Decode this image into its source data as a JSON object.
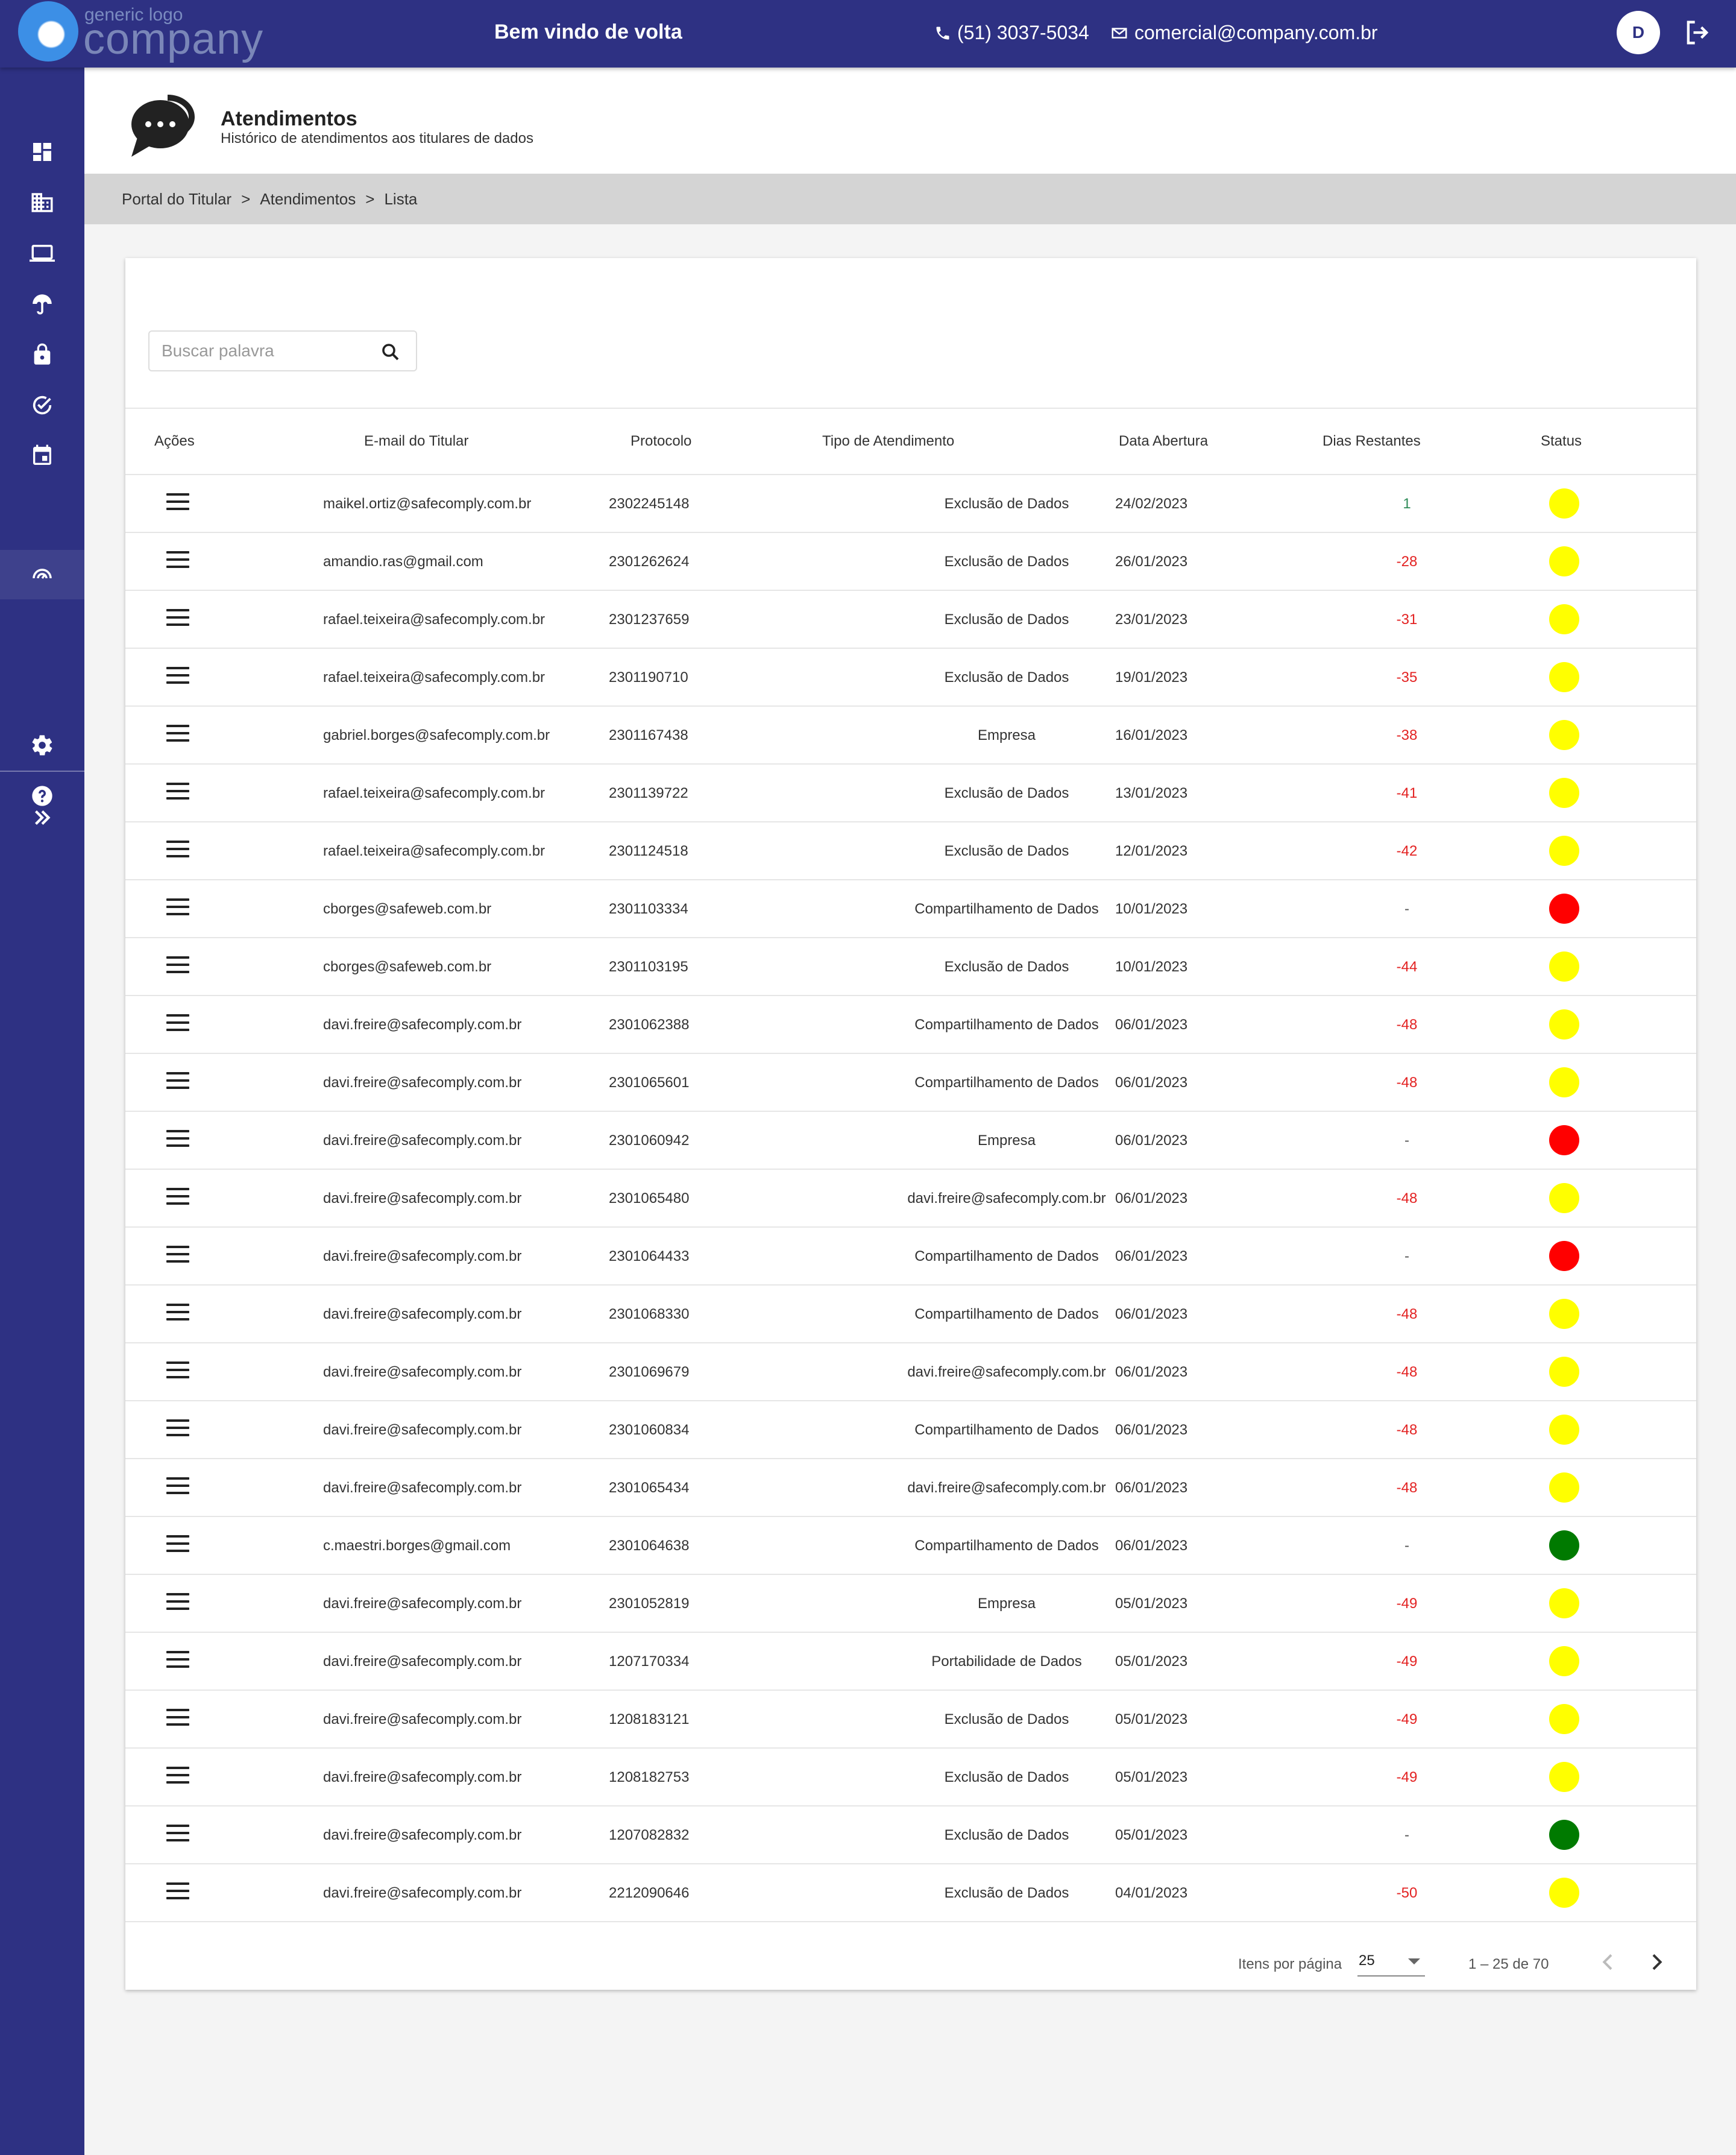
{
  "header": {
    "logo_small": "generic logo",
    "logo_big": "company",
    "welcome": "Bem vindo de volta",
    "phone": "(51) 3037-5034",
    "email": "comercial@company.com.br",
    "avatar_initial": "D"
  },
  "sidebar": {
    "items": [
      "dashboard-icon",
      "building-icon",
      "laptop-icon",
      "umbrella-icon",
      "lock-icon",
      "check-circle-icon",
      "calendar-icon",
      "support-icon",
      "settings-icon",
      "help-icon",
      "expand-icon"
    ],
    "active": "support-icon"
  },
  "page": {
    "title": "Atendimentos",
    "subtitle": "Histórico de atendimentos aos titulares de dados"
  },
  "breadcrumb": [
    "Portal do Titular",
    "Atendimentos",
    "Lista"
  ],
  "breadcrumb_sep": ">",
  "search": {
    "placeholder": "Buscar palavra"
  },
  "table": {
    "headers": {
      "acoes": "Ações",
      "email": "E-mail do Titular",
      "protocolo": "Protocolo",
      "tipo": "Tipo de Atendimento",
      "data": "Data Abertura",
      "dias": "Dias Restantes",
      "status": "Status"
    },
    "status_colors": {
      "yellow": "#ffff00",
      "red": "#ff0000",
      "green": "#007a00"
    },
    "dias_colors": {
      "positive": "#2e8b57",
      "negative": "#e32222",
      "neutral": "#555555"
    },
    "rows": [
      {
        "email": "maikel.ortiz@safecomply.com.br",
        "protocolo": "2302245148",
        "tipo": "Exclusão de Dados",
        "data": "24/02/2023",
        "dias": "1",
        "status": "yellow"
      },
      {
        "email": "amandio.ras@gmail.com",
        "protocolo": "2301262624",
        "tipo": "Exclusão de Dados",
        "data": "26/01/2023",
        "dias": "-28",
        "status": "yellow"
      },
      {
        "email": "rafael.teixeira@safecomply.com.br",
        "protocolo": "2301237659",
        "tipo": "Exclusão de Dados",
        "data": "23/01/2023",
        "dias": "-31",
        "status": "yellow"
      },
      {
        "email": "rafael.teixeira@safecomply.com.br",
        "protocolo": "2301190710",
        "tipo": "Exclusão de Dados",
        "data": "19/01/2023",
        "dias": "-35",
        "status": "yellow"
      },
      {
        "email": "gabriel.borges@safecomply.com.br",
        "protocolo": "2301167438",
        "tipo": "Empresa",
        "data": "16/01/2023",
        "dias": "-38",
        "status": "yellow"
      },
      {
        "email": "rafael.teixeira@safecomply.com.br",
        "protocolo": "2301139722",
        "tipo": "Exclusão de Dados",
        "data": "13/01/2023",
        "dias": "-41",
        "status": "yellow"
      },
      {
        "email": "rafael.teixeira@safecomply.com.br",
        "protocolo": "2301124518",
        "tipo": "Exclusão de Dados",
        "data": "12/01/2023",
        "dias": "-42",
        "status": "yellow"
      },
      {
        "email": "cborges@safeweb.com.br",
        "protocolo": "2301103334",
        "tipo": "Compartilhamento de Dados",
        "data": "10/01/2023",
        "dias": "-",
        "status": "red"
      },
      {
        "email": "cborges@safeweb.com.br",
        "protocolo": "2301103195",
        "tipo": "Exclusão de Dados",
        "data": "10/01/2023",
        "dias": "-44",
        "status": "yellow"
      },
      {
        "email": "davi.freire@safecomply.com.br",
        "protocolo": "2301062388",
        "tipo": "Compartilhamento de Dados",
        "data": "06/01/2023",
        "dias": "-48",
        "status": "yellow"
      },
      {
        "email": "davi.freire@safecomply.com.br",
        "protocolo": "2301065601",
        "tipo": "Compartilhamento de Dados",
        "data": "06/01/2023",
        "dias": "-48",
        "status": "yellow"
      },
      {
        "email": "davi.freire@safecomply.com.br",
        "protocolo": "2301060942",
        "tipo": "Empresa",
        "data": "06/01/2023",
        "dias": "-",
        "status": "red"
      },
      {
        "email": "davi.freire@safecomply.com.br",
        "protocolo": "2301065480",
        "tipo": "davi.freire@safecomply.com.br",
        "data": "06/01/2023",
        "dias": "-48",
        "status": "yellow"
      },
      {
        "email": "davi.freire@safecomply.com.br",
        "protocolo": "2301064433",
        "tipo": "Compartilhamento de Dados",
        "data": "06/01/2023",
        "dias": "-",
        "status": "red"
      },
      {
        "email": "davi.freire@safecomply.com.br",
        "protocolo": "2301068330",
        "tipo": "Compartilhamento de Dados",
        "data": "06/01/2023",
        "dias": "-48",
        "status": "yellow"
      },
      {
        "email": "davi.freire@safecomply.com.br",
        "protocolo": "2301069679",
        "tipo": "davi.freire@safecomply.com.br",
        "data": "06/01/2023",
        "dias": "-48",
        "status": "yellow"
      },
      {
        "email": "davi.freire@safecomply.com.br",
        "protocolo": "2301060834",
        "tipo": "Compartilhamento de Dados",
        "data": "06/01/2023",
        "dias": "-48",
        "status": "yellow"
      },
      {
        "email": "davi.freire@safecomply.com.br",
        "protocolo": "2301065434",
        "tipo": "davi.freire@safecomply.com.br",
        "data": "06/01/2023",
        "dias": "-48",
        "status": "yellow"
      },
      {
        "email": "c.maestri.borges@gmail.com",
        "protocolo": "2301064638",
        "tipo": "Compartilhamento de Dados",
        "data": "06/01/2023",
        "dias": "-",
        "status": "green"
      },
      {
        "email": "davi.freire@safecomply.com.br",
        "protocolo": "2301052819",
        "tipo": "Empresa",
        "data": "05/01/2023",
        "dias": "-49",
        "status": "yellow"
      },
      {
        "email": "davi.freire@safecomply.com.br",
        "protocolo": "1207170334",
        "tipo": "Portabilidade de Dados",
        "data": "05/01/2023",
        "dias": "-49",
        "status": "yellow"
      },
      {
        "email": "davi.freire@safecomply.com.br",
        "protocolo": "1208183121",
        "tipo": "Exclusão de Dados",
        "data": "05/01/2023",
        "dias": "-49",
        "status": "yellow"
      },
      {
        "email": "davi.freire@safecomply.com.br",
        "protocolo": "1208182753",
        "tipo": "Exclusão de Dados",
        "data": "05/01/2023",
        "dias": "-49",
        "status": "yellow"
      },
      {
        "email": "davi.freire@safecomply.com.br",
        "protocolo": "1207082832",
        "tipo": "Exclusão de Dados",
        "data": "05/01/2023",
        "dias": "-",
        "status": "green"
      },
      {
        "email": "davi.freire@safecomply.com.br",
        "protocolo": "2212090646",
        "tipo": "Exclusão de Dados",
        "data": "04/01/2023",
        "dias": "-50",
        "status": "yellow"
      }
    ]
  },
  "pager": {
    "label": "Itens por página",
    "per_page": "25",
    "range": "1 – 25 de 70"
  },
  "colors": {
    "brand": "#2e3183"
  }
}
